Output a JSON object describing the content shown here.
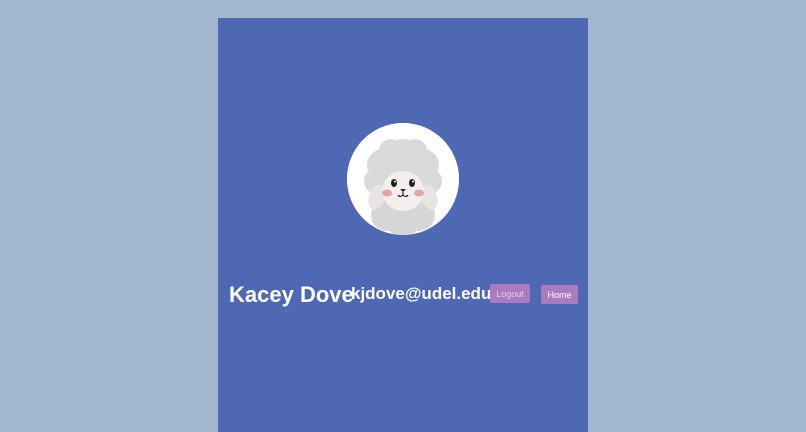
{
  "profile": {
    "name": "Kacey Dove",
    "email": "kjdove@udel.edu",
    "avatar_icon": "sheep-avatar-icon"
  },
  "actions": {
    "logout_label": "Logout",
    "home_label": "Home"
  },
  "colors": {
    "page_background": "#a2b7cd",
    "panel_background": "#4e68b4",
    "button_background": "#a97cc0",
    "text": "#ffffff"
  }
}
